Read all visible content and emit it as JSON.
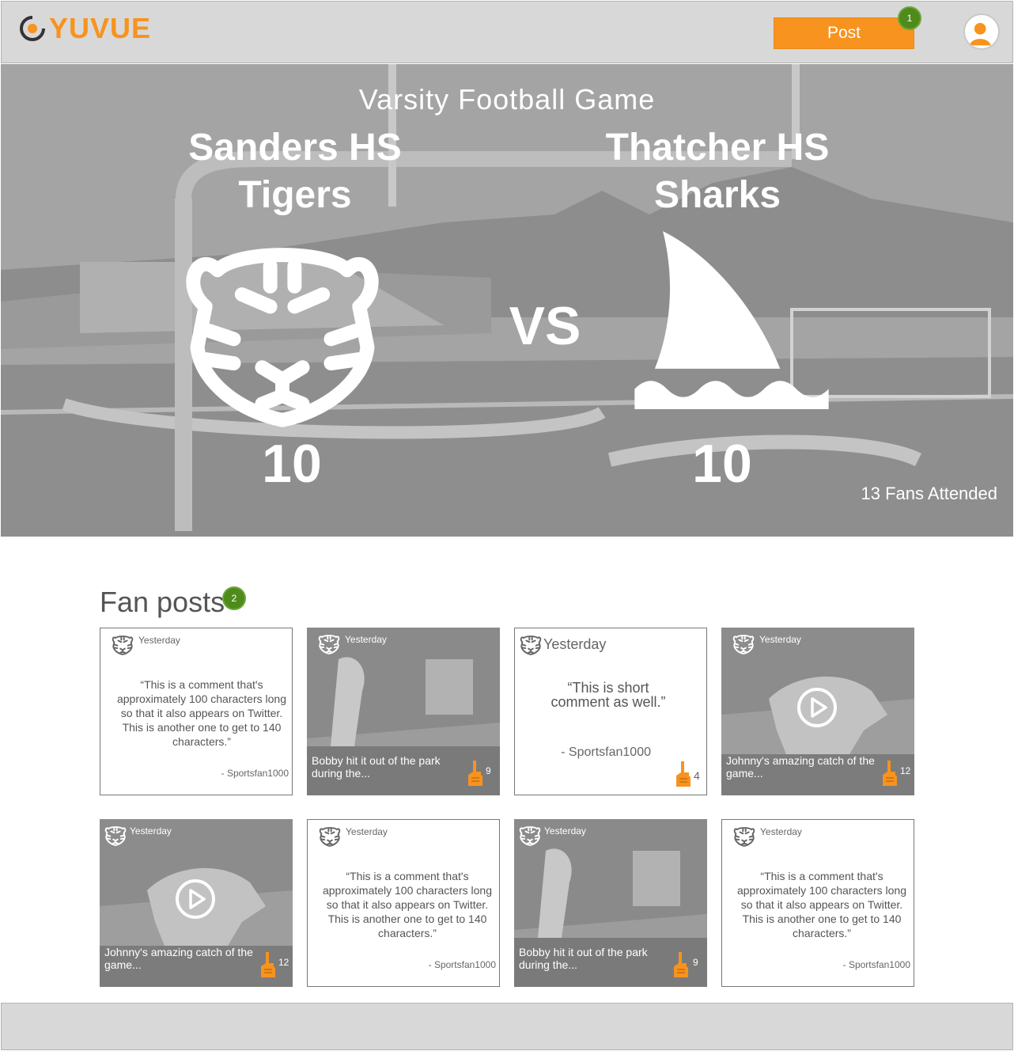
{
  "header": {
    "brand": "YUVUE",
    "post_label": "Post",
    "notification_count": "1",
    "colors": {
      "accent": "#f7931e",
      "badge": "#4e8b1b"
    }
  },
  "game": {
    "title": "Varsity Football Game",
    "vs_label": "VS",
    "home": {
      "school": "Sanders HS",
      "mascot": "Tigers",
      "score": "10",
      "logo_icon": "tiger-head-icon"
    },
    "away": {
      "school": "Thatcher HS",
      "mascot": "Sharks",
      "score": "10",
      "logo_icon": "shark-fin-icon"
    },
    "fans_attended": "13 Fans Attended"
  },
  "fan_posts": {
    "title": "Fan posts",
    "count": "2",
    "posts": [
      {
        "type": "text",
        "date": "Yesterday",
        "quote": "“This is a comment that's approximately 100 characters long so that it also appears on Twitter. This is another one to get to 140 characters.”",
        "author": "- Sportsfan1000"
      },
      {
        "type": "photo",
        "date": "Yesterday",
        "caption": "Bobby hit it out of the park during the...",
        "likes": "9"
      },
      {
        "type": "text",
        "date": "Yesterday",
        "quote": "“This is short comment as well.”",
        "author": "- Sportsfan1000",
        "likes": "4"
      },
      {
        "type": "video",
        "date": "Yesterday",
        "caption": "Johnny's amazing catch of the game...",
        "likes": "12"
      },
      {
        "type": "video",
        "date": "Yesterday",
        "caption": "Johnny's amazing catch of the game...",
        "likes": "12"
      },
      {
        "type": "text",
        "date": "Yesterday",
        "quote": "“This is a comment that's approximately 100 characters long so that it also appears on Twitter. This is another one to get to 140 characters.”",
        "author": "- Sportsfan1000"
      },
      {
        "type": "photo",
        "date": "Yesterday",
        "caption": "Bobby hit it out of the park during the...",
        "likes": "9"
      },
      {
        "type": "text",
        "date": "Yesterday",
        "quote": "“This is a comment that's approximately 100 characters long so that it also appears on Twitter. This is another one to get to 140 characters.”",
        "author": "- Sportsfan1000"
      }
    ]
  }
}
